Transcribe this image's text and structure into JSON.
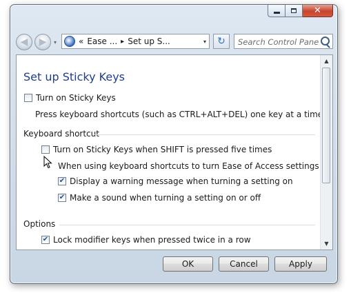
{
  "window": {
    "caption": {
      "minimize_icon": "minimize-icon",
      "maximize_icon": "maximize-icon",
      "close_icon": "close-icon",
      "close_glyph": "✕"
    }
  },
  "navigation": {
    "back_icon": "back-arrow-icon",
    "forward_icon": "forward-arrow-icon",
    "back_glyph": "◀",
    "forward_glyph": "▶",
    "breadcrumb": [
      "Ease ...",
      "Set up S..."
    ],
    "prefix_glyph": "«",
    "separator_glyph": "▸",
    "dropdown_glyph": "▾",
    "refresh_glyph": "↻",
    "search_placeholder": "Search Control Panel"
  },
  "page": {
    "title": "Set up Sticky Keys",
    "turn_on": {
      "label": "Turn on Sticky Keys",
      "checked": false
    },
    "turn_on_description": "Press keyboard shortcuts (such as CTRL+ALT+DEL) one key at a time.",
    "keyboard_shortcut": {
      "heading": "Keyboard shortcut",
      "shift_five": {
        "label": "Turn on Sticky Keys when SHIFT is pressed five times",
        "checked": false
      },
      "subheading": "When using keyboard shortcuts to turn Ease of Access settings on:",
      "warning": {
        "label": "Display a warning message when turning a setting on",
        "checked": true
      },
      "sound": {
        "label": "Make a sound when turning a setting on or off",
        "checked": true
      }
    },
    "options": {
      "heading": "Options",
      "lock_modifier": {
        "label": "Lock modifier keys when pressed twice in a row",
        "checked": true
      }
    }
  },
  "scrollbar": {
    "up_glyph": "▲",
    "down_glyph": "▼"
  },
  "footer": {
    "ok_label": "OK",
    "cancel_label": "Cancel",
    "apply_label": "Apply"
  },
  "colors": {
    "title": "#1f3d8c",
    "frame": "#cfdbe8",
    "check": "#1b4f93"
  }
}
